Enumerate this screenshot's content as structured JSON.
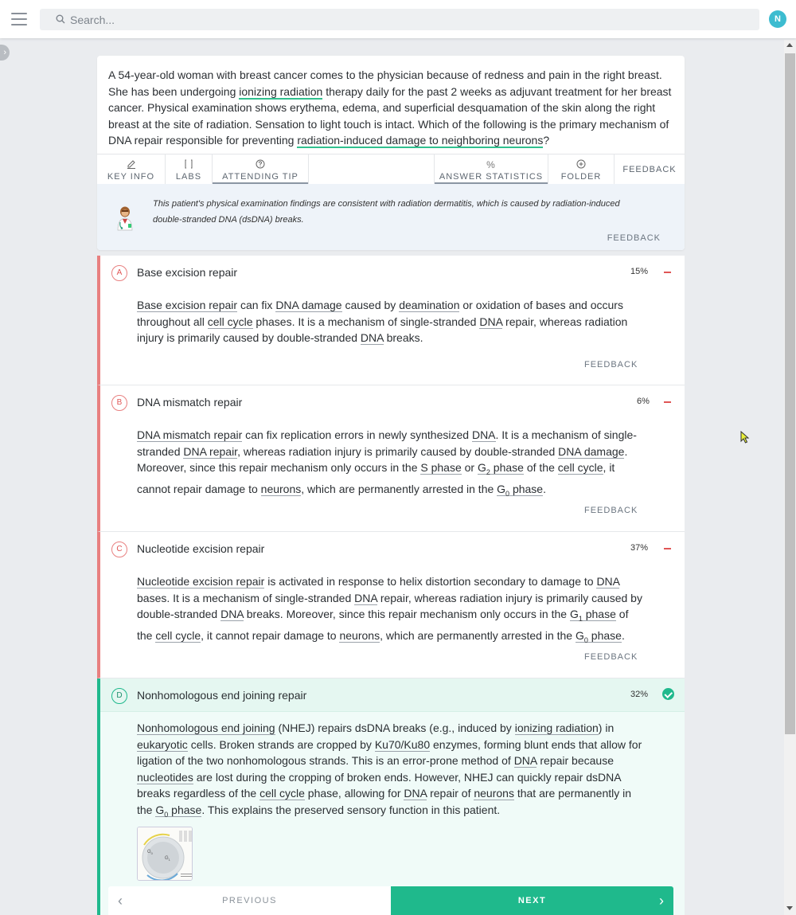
{
  "search": {
    "placeholder": "Search..."
  },
  "user": {
    "initial": "N"
  },
  "question": {
    "p1": "A 54-year-old woman with breast cancer comes to the physician because of redness and pain in the right breast. She has been undergoing ",
    "hl1": "ionizing radiation",
    "p2": " therapy daily for the past 2 weeks as adjuvant treatment for her breast cancer. Physical examination shows erythema, edema, and superficial desquamation of the skin along the right breast at the site of radiation. Sensation to light touch is intact. Which of the following is the primary mechanism of DNA repair responsible for preventing ",
    "hl2": "radiation-induced damage to neighboring neurons",
    "p3": "?"
  },
  "tabs": {
    "key_info": "KEY INFO",
    "labs": "LABS",
    "attending_tip": "ATTENDING TIP",
    "answer_statistics": "ANSWER STATISTICS",
    "folder": "FOLDER",
    "feedback": "FEEDBACK"
  },
  "tip": {
    "text": "This patient's physical examination findings are consistent with radiation dermatitis, which is caused by radiation-induced double-stranded DNA (dsDNA) breaks.",
    "feedback": "FEEDBACK"
  },
  "answers": [
    {
      "letter": "A",
      "title": "Base excision repair",
      "pct": "15%",
      "feedback": "FEEDBACK"
    },
    {
      "letter": "B",
      "title": "DNA mismatch repair",
      "pct": "6%",
      "feedback": "FEEDBACK"
    },
    {
      "letter": "C",
      "title": "Nucleotide excision repair",
      "pct": "37%",
      "feedback": "FEEDBACK"
    },
    {
      "letter": "D",
      "title": "Nonhomologous end joining repair",
      "pct": "32%"
    }
  ],
  "explanations": {
    "a": {
      "t1": "Base excision repair",
      "t2": " can fix ",
      "t3": "DNA damage",
      "t4": " caused by ",
      "t5": "deamination",
      "t6": " or oxidation of bases and occurs throughout all ",
      "t7": "cell cycle",
      "t8": " phases. It is a mechanism of single-stranded ",
      "t9": "DNA",
      "t10": " repair, whereas radiation injury is primarily caused by double-stranded ",
      "t11": "DNA",
      "t12": " breaks."
    },
    "b": {
      "t1": "DNA mismatch repair",
      "t2": " can fix replication errors in newly synthesized ",
      "t3": "DNA",
      "t4": ". It is a mechanism of single-stranded ",
      "t5": "DNA repair",
      "t6": ", whereas radiation injury is primarily caused by double-stranded ",
      "t7": "DNA damage",
      "t8": ". Moreover, since this repair mechanism only occurs in the ",
      "t9": "S phase",
      "t10": " or ",
      "t11": "G",
      "t11s": "2",
      "t12": " phase",
      "t13": " of the ",
      "t14": "cell cycle",
      "t15": ", it cannot repair damage to ",
      "t16": "neurons",
      "t17": ", which are permanently arrested in the ",
      "t18": "G",
      "t18s": "0",
      "t19": " phase",
      "t20": "."
    },
    "c": {
      "t1": "Nucleotide excision repair",
      "t2": " is activated in response to helix distortion secondary to damage to ",
      "t3": "DNA",
      "t4": " bases. It is a mechanism of single-stranded ",
      "t5": "DNA",
      "t6": " repair, whereas radiation injury is primarily caused by double-stranded ",
      "t7": "DNA",
      "t8": " breaks. Moreover, since this repair mechanism only occurs in the ",
      "t9": "G",
      "t9s": "1",
      "t10": " phase",
      "t11": " of the ",
      "t12": "cell cycle",
      "t13": ", it cannot repair damage to ",
      "t14": "neurons",
      "t15": ", which are permanently arrested in the ",
      "t16": "G",
      "t16s": "0",
      "t17": " phase",
      "t18": "."
    },
    "d": {
      "t1": "Nonhomologous end joining",
      "t2": " (NHEJ) repairs dsDNA breaks (e.g., induced by ",
      "t3": "ionizing radiation",
      "t4": ") in ",
      "t5": "eukaryotic",
      "t6": " cells. Broken strands are cropped by ",
      "t7": "Ku70/Ku80",
      "t8": " enzymes, forming blunt ends that allow for ligation of the two nonhomologous strands. This is an error-prone method of ",
      "t9": "DNA",
      "t10": " repair because ",
      "t11": "nucleotides",
      "t12": " are lost during the cropping of broken ends. However, NHEJ can quickly repair dsDNA breaks regardless of the ",
      "t13": "cell cycle",
      "t14": " phase, allowing for ",
      "t15": "DNA",
      "t16": " repair of ",
      "t17": "neurons",
      "t18": " that are permanently in the ",
      "t19": "G",
      "t19s": "0",
      "t20": " phase",
      "t21": ". This explains the preserved sensory function in this patient."
    }
  },
  "thumbnail": {
    "g0": "G",
    "g0s": "0",
    "g1": "G",
    "g1s": "1"
  },
  "nav": {
    "previous": "PREVIOUS",
    "next": "NEXT"
  },
  "colors": {
    "accent": "#1fb98c",
    "incorrect": "#e88080",
    "avatar": "#3dbcd0"
  }
}
